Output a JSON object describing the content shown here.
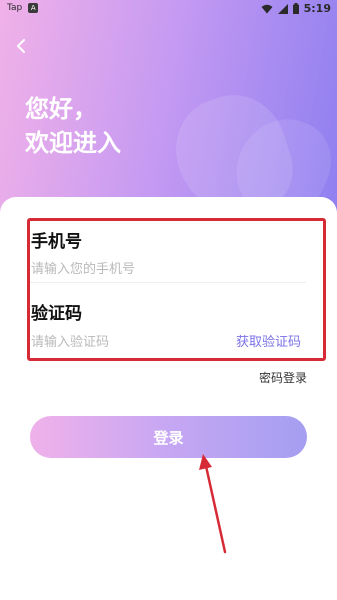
{
  "status_bar": {
    "app_name": "Tap",
    "app_icon_letter": "A",
    "time": "5:19"
  },
  "header": {
    "greeting_line1": "您好，",
    "greeting_line2": "欢迎进入"
  },
  "form": {
    "phone_label": "手机号",
    "phone_placeholder": "请输入您的手机号",
    "code_label": "验证码",
    "code_placeholder": "请输入验证码",
    "get_code_label": "获取验证码"
  },
  "password_login_label": "密码登录",
  "login_button_label": "登录",
  "colors": {
    "accent": "#7c72e8",
    "highlight_box": "#d62b36",
    "arrow": "#d62b36"
  },
  "icons": {
    "back": "chevron-left-icon",
    "wifi": "wifi-icon",
    "signal": "signal-icon",
    "battery": "battery-icon"
  }
}
